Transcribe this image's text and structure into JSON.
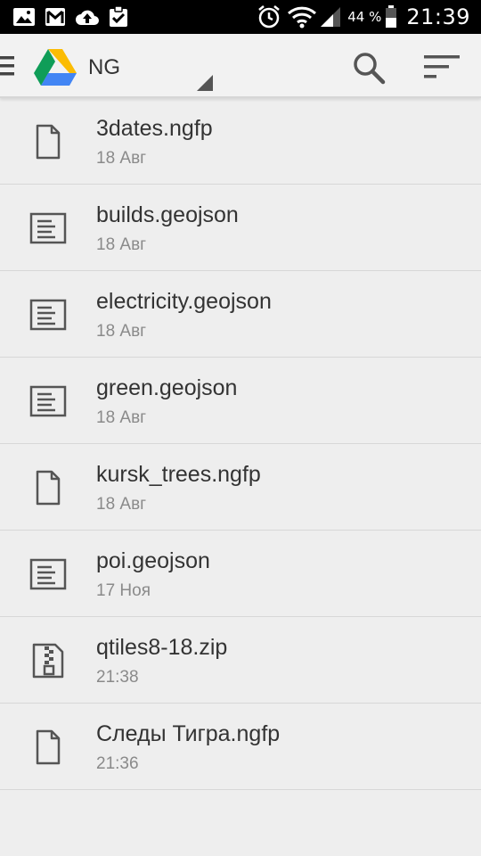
{
  "status_bar": {
    "icons": [
      "gallery-icon",
      "gmail-icon",
      "cloud-upload-icon",
      "clipboard-check-icon"
    ],
    "battery_percent": "44 %",
    "time": "21:39"
  },
  "action_bar": {
    "title": "NG",
    "icons": [
      "menu-icon",
      "google-drive-logo",
      "dropdown-triangle-icon",
      "search-icon",
      "sort-icon"
    ]
  },
  "files": [
    {
      "name": "3dates.ngfp",
      "date": "18 Авг",
      "icon": "file-icon"
    },
    {
      "name": "builds.geojson",
      "date": "18 Авг",
      "icon": "text-document-icon"
    },
    {
      "name": "electricity.geojson",
      "date": "18 Авг",
      "icon": "text-document-icon"
    },
    {
      "name": "green.geojson",
      "date": "18 Авг",
      "icon": "text-document-icon"
    },
    {
      "name": "kursk_trees.ngfp",
      "date": "18 Авг",
      "icon": "file-icon"
    },
    {
      "name": "poi.geojson",
      "date": "17 Ноя",
      "icon": "text-document-icon"
    },
    {
      "name": "qtiles8-18.zip",
      "date": "21:38",
      "icon": "zip-archive-icon"
    },
    {
      "name": "Следы Тигра.ngfp",
      "date": "21:36",
      "icon": "file-icon"
    }
  ]
}
